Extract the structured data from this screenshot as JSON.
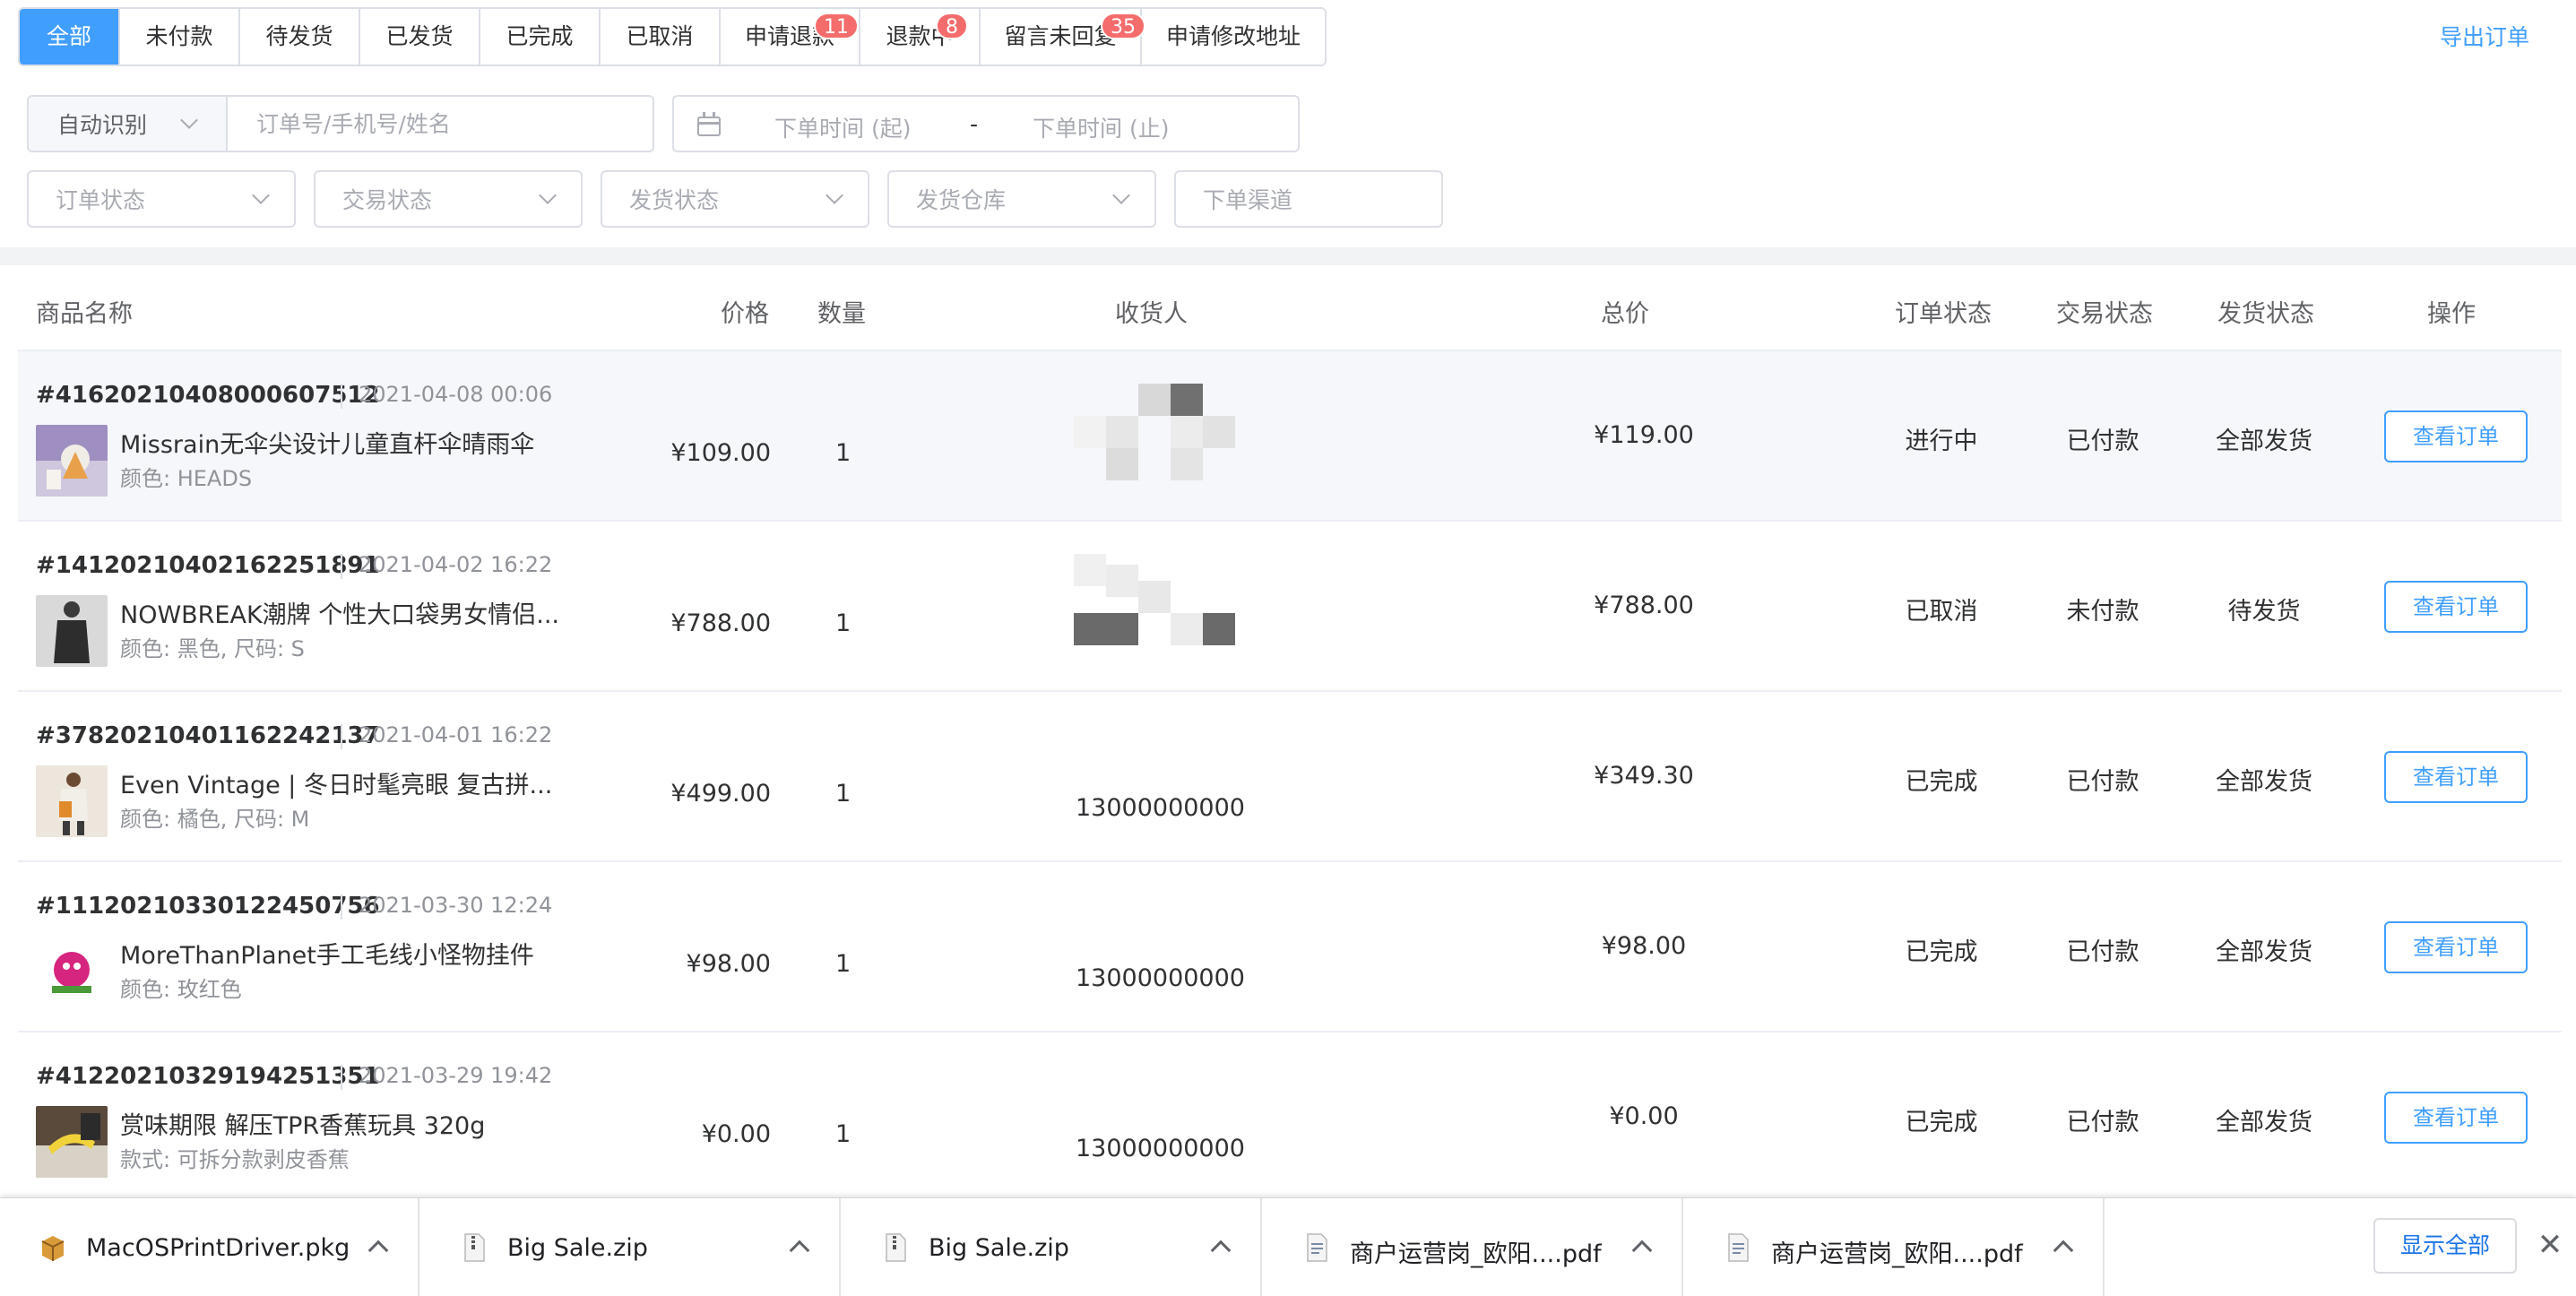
{
  "tabs": [
    {
      "label": "全部",
      "badge": ""
    },
    {
      "label": "未付款",
      "badge": ""
    },
    {
      "label": "待发货",
      "badge": ""
    },
    {
      "label": "已发货",
      "badge": ""
    },
    {
      "label": "已完成",
      "badge": ""
    },
    {
      "label": "已取消",
      "badge": ""
    },
    {
      "label": "申请退款",
      "badge": "11"
    },
    {
      "label": "退款中",
      "badge": "8"
    },
    {
      "label": "留言未回复",
      "badge": "35"
    },
    {
      "label": "申请修改地址",
      "badge": ""
    }
  ],
  "export_label": "导出订单",
  "filters": {
    "search_mode": "自动识别",
    "search_placeholder": "订单号/手机号/姓名",
    "date_start_placeholder": "下单时间 (起)",
    "date_sep": "-",
    "date_end_placeholder": "下单时间 (止)",
    "order_status": "订单状态",
    "trade_status": "交易状态",
    "ship_status": "发货状态",
    "warehouse": "发货仓库",
    "channel_placeholder": "下单渠道"
  },
  "columns": {
    "product": "商品名称",
    "price": "价格",
    "qty": "数量",
    "receiver": "收货人",
    "total": "总价",
    "order_status": "订单状态",
    "trade_status": "交易状态",
    "ship_status": "发货状态",
    "action": "操作"
  },
  "orders": [
    {
      "no": "#41620210408000607512",
      "time": "2021-04-08 00:06",
      "name": "Missrain无伞尖设计儿童直杆伞晴雨伞",
      "spec": "颜色: HEADS",
      "price": "¥109.00",
      "qty": "1",
      "phone": "",
      "total": "¥119.00",
      "order_status": "进行中",
      "trade_status": "已付款",
      "ship_status": "全部发货",
      "action": "查看订单"
    },
    {
      "no": "#14120210402162251891",
      "time": "2021-04-02 16:22",
      "name": "NOWBREAK潮牌 个性大口袋男女情侣...",
      "spec": "颜色: 黑色, 尺码: S",
      "price": "¥788.00",
      "qty": "1",
      "phone": "",
      "total": "¥788.00",
      "order_status": "已取消",
      "trade_status": "未付款",
      "ship_status": "待发货",
      "action": "查看订单"
    },
    {
      "no": "#37820210401162242137",
      "time": "2021-04-01 16:22",
      "name": "Even Vintage | 冬日时髦亮眼 复古拼...",
      "spec": "颜色: 橘色, 尺码: M",
      "price": "¥499.00",
      "qty": "1",
      "phone": "13000000000",
      "total": "¥349.30",
      "order_status": "已完成",
      "trade_status": "已付款",
      "ship_status": "全部发货",
      "action": "查看订单"
    },
    {
      "no": "#11120210330122450756",
      "time": "2021-03-30 12:24",
      "name": "MoreThanPlanet手工毛线小怪物挂件",
      "spec": "颜色: 玫红色",
      "price": "¥98.00",
      "qty": "1",
      "phone": "13000000000",
      "total": "¥98.00",
      "order_status": "已完成",
      "trade_status": "已付款",
      "ship_status": "全部发货",
      "action": "查看订单"
    },
    {
      "no": "#41220210329194251351",
      "time": "2021-03-29 19:42",
      "name": "赏味期限 解压TPR香蕉玩具 320g",
      "spec": "款式: 可拆分款剥皮香蕉",
      "price": "¥0.00",
      "qty": "1",
      "phone": "13000000000",
      "total": "¥0.00",
      "order_status": "已完成",
      "trade_status": "已付款",
      "ship_status": "全部发货",
      "action": "查看订单"
    }
  ],
  "downloads": [
    {
      "name": "MacOSPrintDriver.pkg",
      "icon": "package-icon"
    },
    {
      "name": "Big Sale.zip",
      "icon": "zip-file-icon"
    },
    {
      "name": "Big Sale.zip",
      "icon": "zip-file-icon"
    },
    {
      "name": "商户运营岗_欧阳....pdf",
      "icon": "pdf-file-icon"
    },
    {
      "name": "商户运营岗_欧阳....pdf",
      "icon": "pdf-file-icon"
    }
  ],
  "show_all_label": "显示全部",
  "close_glyph": "✕",
  "colors": {
    "primary": "#409eff",
    "badge": "#f56c6c",
    "border": "#dcdfe6",
    "highlight_row": "#f5f7fa"
  }
}
